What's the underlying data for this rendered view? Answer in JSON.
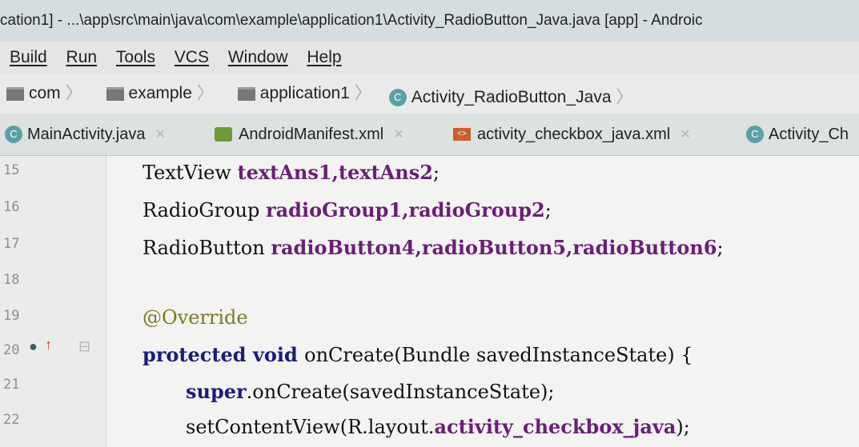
{
  "window": {
    "title": "cation1] - ...\\app\\src\\main\\java\\com\\example\\application1\\Activity_RadioButton_Java.java [app] - Androic"
  },
  "menu": {
    "items": [
      "Build",
      "Run",
      "Tools",
      "VCS",
      "Window",
      "Help"
    ]
  },
  "breadcrumb": {
    "items": [
      "com",
      "example",
      "application1",
      "Activity_RadioButton_Java"
    ]
  },
  "tabs": [
    {
      "label": "MainActivity.java",
      "icon": "class-icon"
    },
    {
      "label": "AndroidManifest.xml",
      "icon": "manifest-icon"
    },
    {
      "label": "activity_checkbox_java.xml",
      "icon": "xml-icon"
    },
    {
      "label": "Activity_Ch",
      "icon": "class-icon"
    }
  ],
  "editor": {
    "lines": [
      {
        "number": "15",
        "code": {
          "type": "TextView ",
          "fields": "textAns1,textAns2",
          "end": ";"
        }
      },
      {
        "number": "16",
        "code": {
          "type": "RadioGroup ",
          "fields": "radioGroup1,radioGroup2",
          "end": ";"
        }
      },
      {
        "number": "17",
        "code": {
          "type": "RadioButton ",
          "fields": "radioButton4,radioButton5,radioButton6",
          "end": ";"
        }
      },
      {
        "number": "18",
        "code": {}
      },
      {
        "number": "19",
        "code": {
          "annotation": "@Override"
        }
      },
      {
        "number": "20",
        "code": {
          "kw1": "protected ",
          "kw2": "void ",
          "rest": "onCreate(Bundle savedInstanceState) {"
        }
      },
      {
        "number": "21",
        "code": {
          "kw": "super",
          "rest": ".onCreate(savedInstanceState);"
        }
      },
      {
        "number": "22",
        "code": {
          "rest": "setContentView(R.layout.",
          "field": "activity_checkbox_java",
          "end": ");"
        }
      }
    ]
  },
  "colors": {
    "keyword": "#1b1b80",
    "field": "#6a1f76",
    "annotation": "#7a7a24"
  }
}
